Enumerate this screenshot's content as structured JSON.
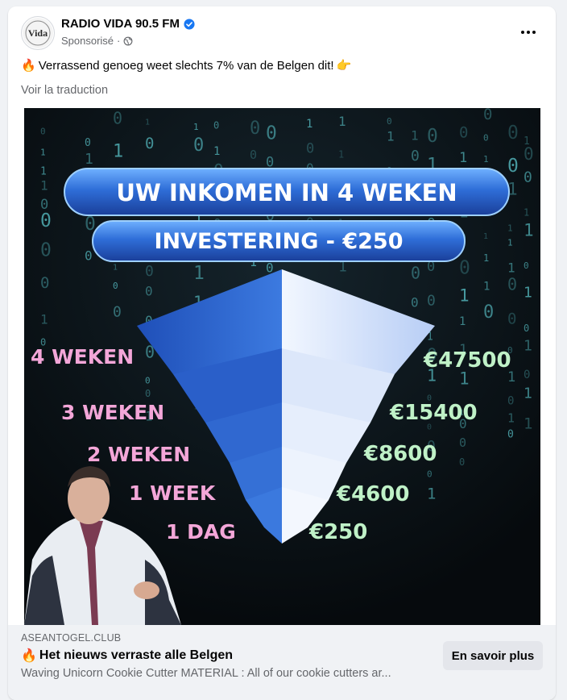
{
  "post": {
    "page_name": "RADIO VIDA 90.5 FM",
    "sponsored_label": "Sponsorisé",
    "separator": "·",
    "text": "Verrassend genoeg weet slechts 7% van de Belgen dit!",
    "see_translation": "Voir la traduction",
    "avatar_text": "Vida"
  },
  "ad_image": {
    "headline": "UW INKOMEN IN 4 WEKEN",
    "investment": "INVESTERING - €250",
    "tiers": [
      {
        "period": "4 WEKEN",
        "amount": "€47500"
      },
      {
        "period": "3 WEKEN",
        "amount": "€15400"
      },
      {
        "period": "2 WEKEN",
        "amount": "€8600"
      },
      {
        "period": "1 WEEK",
        "amount": "€4600"
      },
      {
        "period": "1 DAG",
        "amount": "€250"
      }
    ],
    "colors": {
      "background": "#0c1116",
      "tier_label": "#f3a6d8",
      "amount": "#bff1c7",
      "binary": "#5fd0d6",
      "pill": "#2f6ed8"
    }
  },
  "link": {
    "domain": "ASEANTOGEL.CLUB",
    "title": "Het nieuws verraste alle Belgen",
    "description": "Waving Unicorn Cookie Cutter MATERIAL : All of our cookie cutters ar...",
    "cta_label": "En savoir plus"
  },
  "icons": {
    "verified": "verified-badge-icon",
    "globe": "globe-icon",
    "fire": "fire-emoji",
    "pointing": "pointing-hand-emoji",
    "more": "more-options-icon"
  }
}
